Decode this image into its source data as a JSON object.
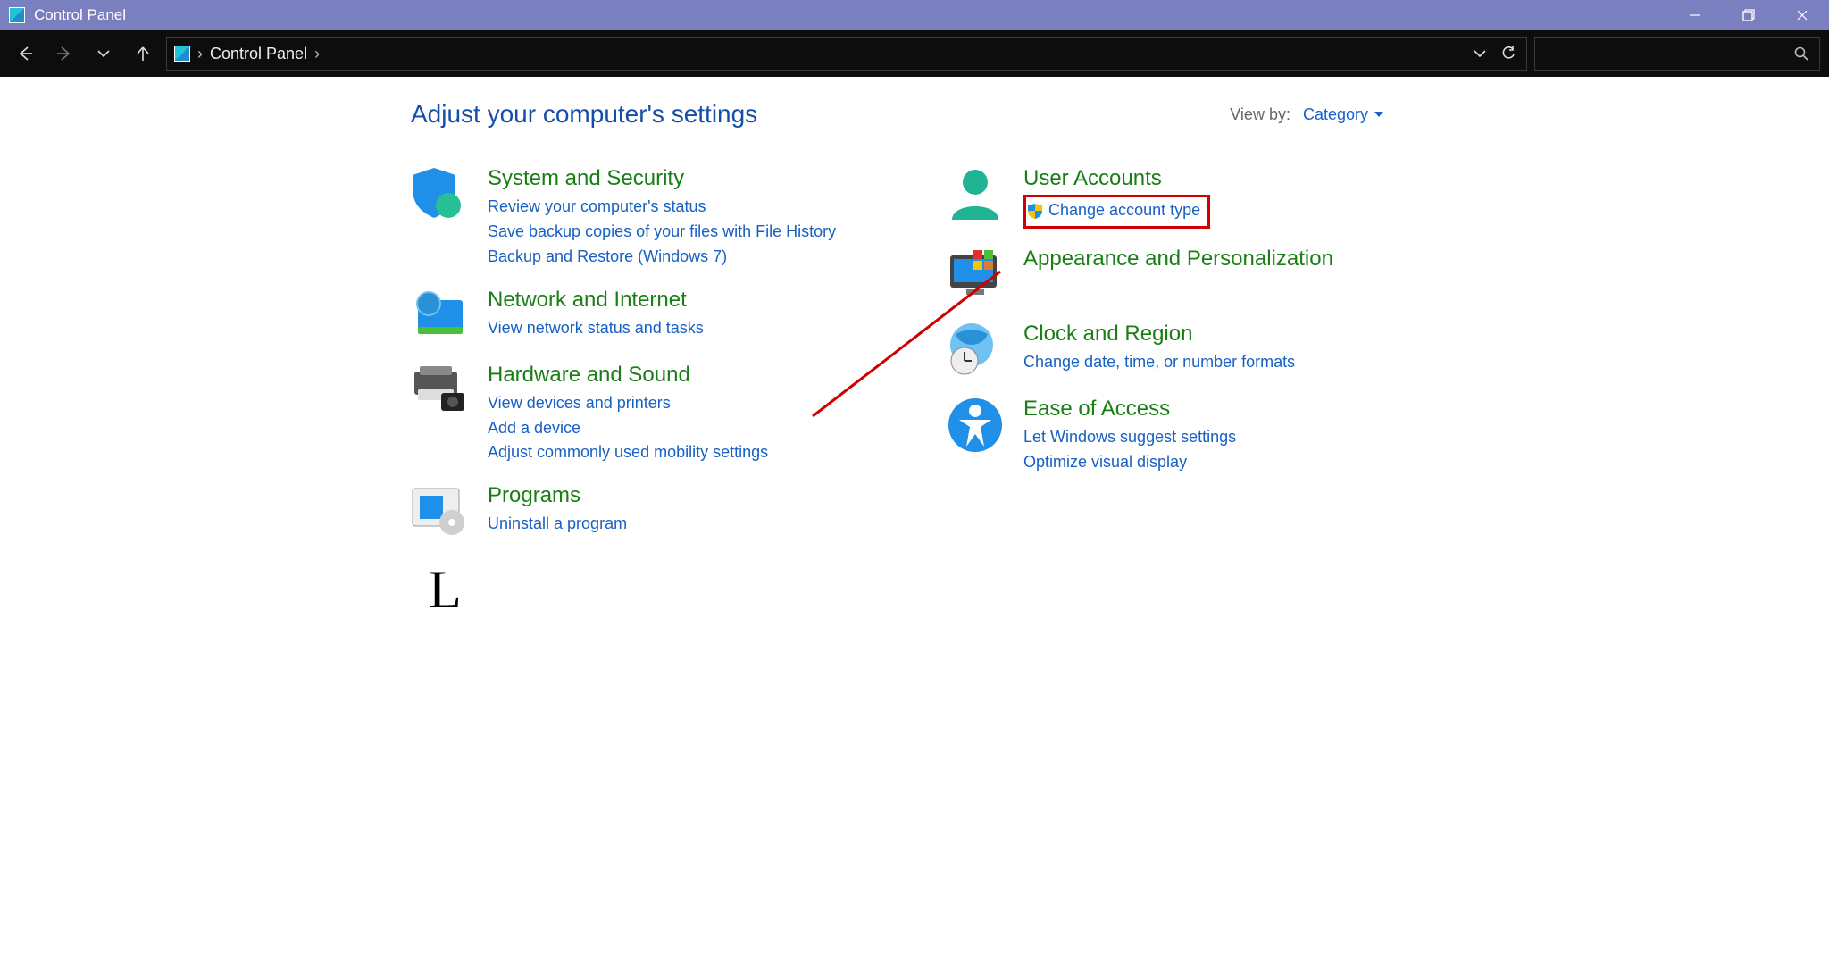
{
  "window": {
    "title": "Control Panel"
  },
  "breadcrumb": {
    "root": "Control Panel"
  },
  "page": {
    "title": "Adjust your computer's settings",
    "viewby_label": "View by:",
    "viewby_value": "Category"
  },
  "left": {
    "system_security": {
      "title": "System and Security",
      "l0": "Review your computer's status",
      "l1": "Save backup copies of your files with File History",
      "l2": "Backup and Restore (Windows 7)"
    },
    "network": {
      "title": "Network and Internet",
      "l0": "View network status and tasks"
    },
    "hardware": {
      "title": "Hardware and Sound",
      "l0": "View devices and printers",
      "l1": "Add a device",
      "l2": "Adjust commonly used mobility settings"
    },
    "programs": {
      "title": "Programs",
      "l0": "Uninstall a program"
    }
  },
  "right": {
    "user_accounts": {
      "title": "User Accounts",
      "l0": "Change account type"
    },
    "appearance": {
      "title": "Appearance and Personalization"
    },
    "clock": {
      "title": "Clock and Region",
      "l0": "Change date, time, or number formats"
    },
    "ease": {
      "title": "Ease of Access",
      "l0": "Let Windows suggest settings",
      "l1": "Optimize visual display"
    }
  },
  "annotation": {
    "L": "L"
  }
}
